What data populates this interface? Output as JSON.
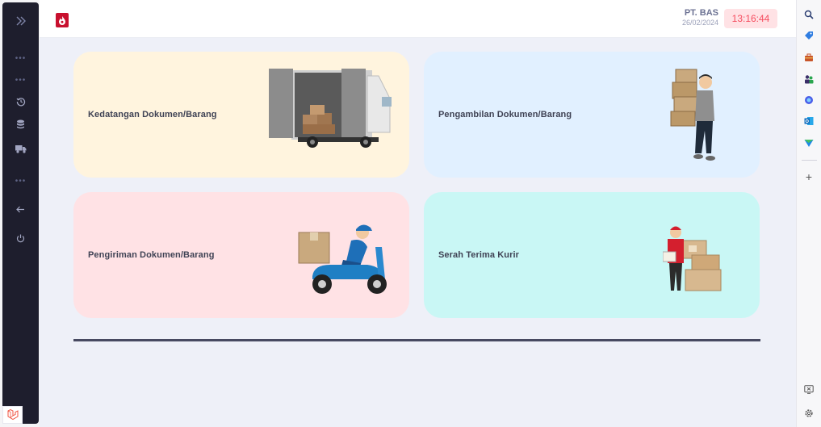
{
  "sidebar": {
    "toggle_icon": "double-chevron-right-icon",
    "items": [
      {
        "name": "dots-1",
        "icon": "more-icon"
      },
      {
        "name": "dots-2",
        "icon": "more-icon"
      },
      {
        "name": "history",
        "icon": "history-icon"
      },
      {
        "name": "database",
        "icon": "database-icon"
      },
      {
        "name": "truck",
        "icon": "truck-icon"
      },
      {
        "name": "dots-3",
        "icon": "more-icon"
      },
      {
        "name": "back",
        "icon": "arrow-left-icon"
      },
      {
        "name": "power",
        "icon": "power-icon"
      }
    ]
  },
  "header": {
    "company_name": "PT. BAS",
    "date": "26/02/2024",
    "time": "13:16:44"
  },
  "cards": [
    {
      "label": "Kedatangan Dokumen/Barang",
      "color": "#fff4de",
      "art": "truck-delivery-illustration"
    },
    {
      "label": "Pengambilan Dokumen/Barang",
      "color": "#e1f0ff",
      "art": "man-carrying-boxes-illustration"
    },
    {
      "label": "Pengiriman Dokumen/Barang",
      "color": "#ffe2e5",
      "art": "scooter-courier-illustration"
    },
    {
      "label": "Serah Terima Kurir",
      "color": "#c9f7f5",
      "art": "courier-handover-illustration"
    }
  ],
  "colors": {
    "accent_red": "#c8102e",
    "sidebar_bg": "#1e1e2d",
    "main_bg": "#eef0f8"
  }
}
